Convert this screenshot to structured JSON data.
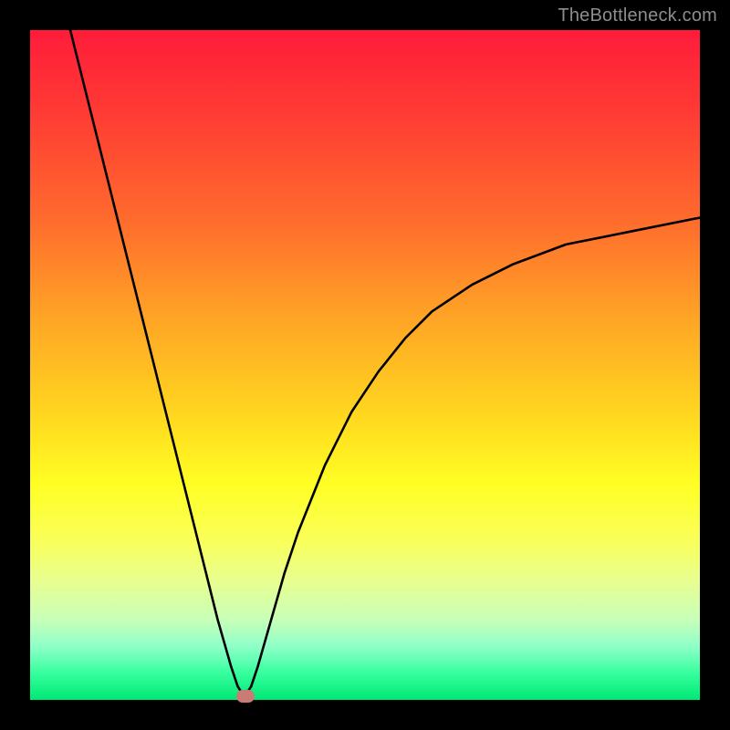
{
  "watermark": "TheBottleneck.com",
  "chart_data": {
    "type": "line",
    "title": "",
    "xlabel": "",
    "ylabel": "",
    "xlim": [
      0,
      100
    ],
    "ylim": [
      0,
      100
    ],
    "grid": false,
    "series": [
      {
        "name": "bottleneck-curve",
        "x": [
          6,
          8,
          10,
          12,
          14,
          16,
          18,
          20,
          22,
          24,
          26,
          28,
          30,
          31,
          32,
          33,
          34,
          36,
          38,
          40,
          44,
          48,
          52,
          56,
          60,
          66,
          72,
          80,
          90,
          100
        ],
        "y": [
          100,
          92,
          84,
          76,
          68,
          60,
          52,
          44,
          36,
          28,
          20,
          12,
          5,
          2,
          0.5,
          2,
          5,
          12,
          19,
          25,
          35,
          43,
          49,
          54,
          58,
          62,
          65,
          68,
          70,
          72
        ]
      }
    ],
    "marker": {
      "x_pct": 32.2,
      "y_pct": 0.6
    },
    "colors": {
      "gradient_top": "#ff1c3a",
      "gradient_bottom": "#00e874",
      "curve": "#000000",
      "marker": "#c97c76",
      "background": "#000000"
    }
  }
}
